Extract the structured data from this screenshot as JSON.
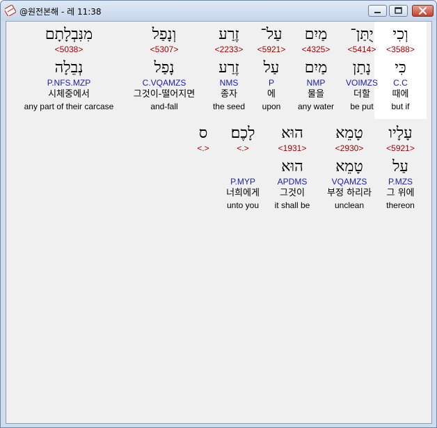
{
  "window": {
    "title": "@원전본해 - 레 11:38"
  },
  "rows": [
    {
      "words": [
        {
          "hebrew": "וְכִי",
          "strong": "<3588>",
          "lemma": "כִּי",
          "parse": "C.C",
          "korean": "때에",
          "english": "but if",
          "selected": true
        },
        {
          "hebrew": "יֻתַּן־",
          "strong": "<5414>",
          "lemma": "נָתַן",
          "parse": "VOIMZS",
          "korean": "더할",
          "english": "be put"
        },
        {
          "hebrew": "מַיִם",
          "strong": "<4325>",
          "lemma": "מַיִם",
          "parse": "NMP",
          "korean": "물을",
          "english": "any water"
        },
        {
          "hebrew": "עַל־",
          "strong": "<5921>",
          "lemma": "עַל",
          "parse": "P",
          "korean": "에",
          "english": "upon"
        },
        {
          "hebrew": "זֶרַע",
          "strong": "<2233>",
          "lemma": "זֶרַע",
          "parse": "NMS",
          "korean": "종자",
          "english": "the seed"
        },
        {
          "hebrew": "וְנָפַל",
          "strong": "<5307>",
          "lemma": "נָפַל",
          "parse": "C.VQAMZS",
          "korean": "그것이-떨어지면",
          "english": "and-fall"
        },
        {
          "hebrew": "מִנִּבְלָתָם",
          "strong": "<5038>",
          "lemma": "נְבֵלָה",
          "parse": "P.NFS.MZP",
          "korean": "시체중에서",
          "english": "any part of their carcase"
        }
      ]
    },
    {
      "words": [
        {
          "hebrew": "עָלָיו",
          "strong": "<5921>",
          "lemma": "עַל",
          "parse": "P.MZS",
          "korean": "그 위에",
          "english": "thereon"
        },
        {
          "hebrew": "טָמֵא",
          "strong": "<2930>",
          "lemma": "טָמֵא",
          "parse": "VQAMZS",
          "korean": "부정 하리라",
          "english": "unclean"
        },
        {
          "hebrew": "הוּא",
          "strong": "<1931>",
          "lemma": "הוּא",
          "parse": "APDMS",
          "korean": "그것이",
          "english": "it shall be"
        },
        {
          "hebrew": "לָכֶם׃",
          "strong": "<.>",
          "lemma": "",
          "parse": "P.MYP",
          "korean": "너희에게",
          "english": "unto you"
        },
        {
          "hebrew": "ס",
          "strong": "<.>",
          "lemma": "",
          "parse": "",
          "korean": "",
          "english": ""
        }
      ]
    }
  ],
  "icon_names": {
    "app": "app-icon",
    "minimize": "minimize-icon",
    "maximize": "maximize-icon",
    "close": "close-icon"
  },
  "colors": {
    "strong": "#a00000",
    "parse": "#1a1ab0",
    "background": "#f0f0f0"
  }
}
